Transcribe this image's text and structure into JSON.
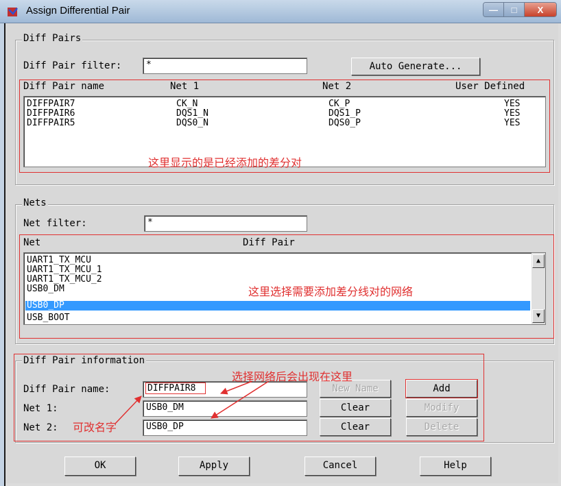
{
  "window": {
    "title": "Assign Differential Pair",
    "minimize": "—",
    "maximize": "□",
    "close": "X"
  },
  "diff_pairs": {
    "legend": "Diff Pairs",
    "filter_label": "Diff Pair filter:",
    "filter_value": "*",
    "auto_generate": "Auto Generate...",
    "columns": [
      "Diff Pair name",
      "Net 1",
      "Net 2",
      "User Defined"
    ],
    "rows": [
      {
        "name": "DIFFPAIR7",
        "net1": "CK_N",
        "net2": "CK_P",
        "user_defined": "YES"
      },
      {
        "name": "DIFFPAIR6",
        "net1": "DQS1_N",
        "net2": "DQS1_P",
        "user_defined": "YES"
      },
      {
        "name": "DIFFPAIR5",
        "net1": "DQS0_N",
        "net2": "DQS0_P",
        "user_defined": "YES"
      }
    ],
    "note": "这里显示的是已经添加的差分对"
  },
  "nets": {
    "legend": "Nets",
    "filter_label": "Net filter:",
    "filter_value": "*",
    "columns": [
      "Net",
      "Diff Pair"
    ],
    "items": [
      "UART1_TX_MCU",
      "UART1_TX_MCU_1",
      "UART1_TX_MCU_2",
      "USB0_DM",
      "USB0_DP",
      "USB_BOOT"
    ],
    "selected": "USB0_DP",
    "note": "这里选择需要添加差分线对的网络",
    "scroll_up": "▲",
    "scroll_down": "▼"
  },
  "info": {
    "legend": "Diff Pair information",
    "name_label": "Diff Pair name:",
    "name_value": "DIFFPAIR8",
    "net1_label": "Net 1:",
    "net1_value": "USB0_DM",
    "net2_label": "Net 2:",
    "net2_value": "USB0_DP",
    "new_name": "New Name",
    "clear1": "Clear",
    "clear2": "Clear",
    "add": "Add",
    "modify": "Modify",
    "delete": "Delete",
    "note_appear": "选择网络后会出现在这里",
    "note_rename": "可改名字"
  },
  "footer": {
    "ok": "OK",
    "apply": "Apply",
    "cancel": "Cancel",
    "help": "Help"
  },
  "colors": {
    "annotation": "#e03030",
    "selection": "#3399ff"
  }
}
